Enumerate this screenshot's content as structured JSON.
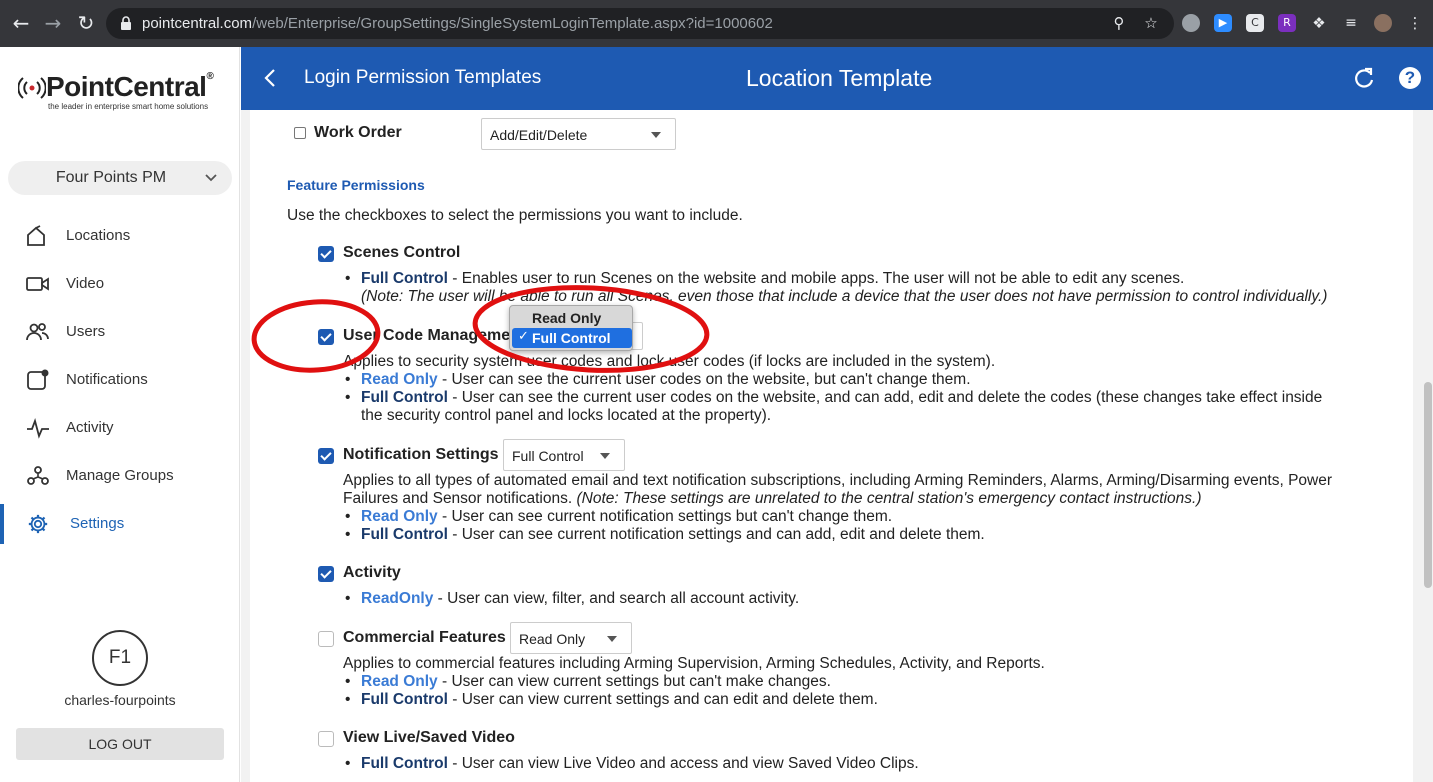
{
  "browser": {
    "url_host": "pointcentral.com",
    "url_path": "/web/Enterprise/GroupSettings/SingleSystemLoginTemplate.aspx?id=1000602"
  },
  "sidebar": {
    "brand": "PointCentral",
    "brand_mark": "®",
    "tagline": "the leader in enterprise smart home solutions",
    "org": "Four Points PM",
    "items": [
      {
        "label": "Locations",
        "icon": "home-icon"
      },
      {
        "label": "Video",
        "icon": "video-camera-icon"
      },
      {
        "label": "Users",
        "icon": "users-icon"
      },
      {
        "label": "Notifications",
        "icon": "notification-icon"
      },
      {
        "label": "Activity",
        "icon": "activity-pulse-icon"
      },
      {
        "label": "Manage Groups",
        "icon": "groups-icon"
      },
      {
        "label": "Settings",
        "icon": "gear-icon",
        "active": true
      }
    ],
    "avatar_initials": "F1",
    "username": "charles-fourpoints",
    "logout": "LOG OUT"
  },
  "header": {
    "back_label": "Login Permission Templates",
    "title": "Location Template"
  },
  "work_order": {
    "label": "Work Order",
    "value": "Add/Edit/Delete"
  },
  "feature": {
    "heading": "Feature Permissions",
    "description": "Use the checkboxes to select the permissions you want to include."
  },
  "scenes": {
    "title": "Scenes Control",
    "b1_kw": "Full Control",
    "b1_text": " - Enables user to run Scenes on the website and mobile apps. The user will not be able to edit any scenes.",
    "note": "(Note: The user will be able to run all Scenes, even those that include a device that the user does not have permission to control individually.)"
  },
  "usercode": {
    "title": "User Code Management",
    "desc": "Applies to security system user codes and lock user codes (if locks are included in the system).",
    "b1_kw": "Read Only",
    "b1_text": " - User can see the current user codes on the website, but can't change them.",
    "b2_kw": "Full Control",
    "b2_text": " - User can see the current user codes on the website, and can add, edit and delete the codes (these changes take effect inside",
    "b2_cont": "the security control panel and locks located at the property).",
    "dropdown_options": [
      "Read Only",
      "Full Control"
    ],
    "dropdown_selected": "Full Control"
  },
  "notif": {
    "title": "Notification Settings",
    "value": "Full Control",
    "desc1": "Applies to all types of automated email and text notification subscriptions, including Arming Reminders, Alarms, Arming/Disarming events, Power",
    "desc2": "Failures and Sensor notifications. ",
    "desc2_note": "(Note: These settings are unrelated to the central station's emergency contact instructions.)",
    "b1_kw": "Read Only",
    "b1_text": " - User can see current notification settings but can't change them.",
    "b2_kw": "Full Control",
    "b2_text": " - User can see current notification settings and can add, edit and delete them."
  },
  "activity": {
    "title": "Activity",
    "b1_kw": "ReadOnly",
    "b1_text": " - User can view, filter, and search all account activity."
  },
  "commercial": {
    "title": "Commercial Features",
    "value": "Read Only",
    "desc": "Applies to commercial features including Arming Supervision, Arming Schedules, Activity, and Reports.",
    "b1_kw": "Read Only",
    "b1_text": " - User can view current settings but can't make changes.",
    "b2_kw": "Full Control",
    "b2_text": " - User can view current settings and can edit and delete them."
  },
  "video": {
    "title": "View Live/Saved Video",
    "b1_kw": "Full Control",
    "b1_text": " - User can view Live Video and access and view Saved Video Clips."
  },
  "colors": {
    "header_blue": "#1e5ab2",
    "checkbox_blue": "#1e5ab2",
    "annotation_red": "#e01010"
  }
}
